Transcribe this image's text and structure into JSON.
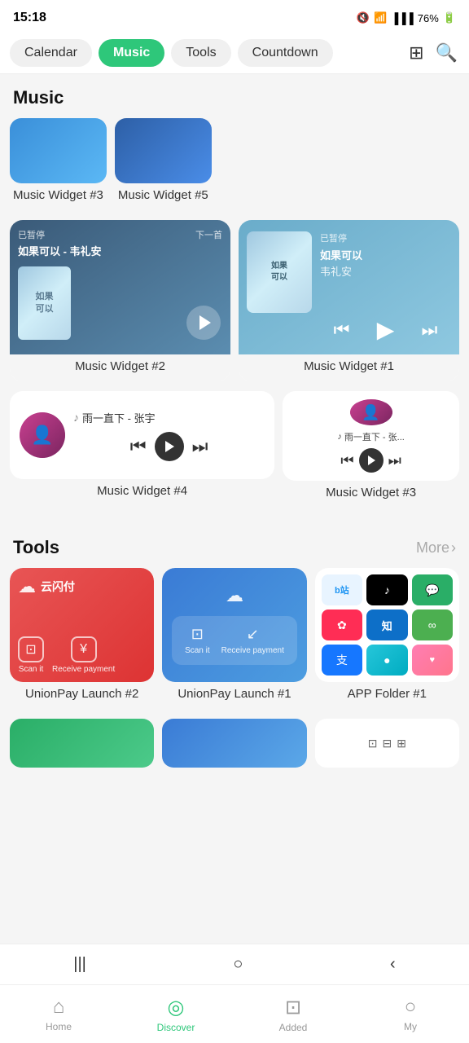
{
  "statusBar": {
    "time": "15:18",
    "battery": "76%"
  },
  "tabs": {
    "items": [
      {
        "id": "calendar",
        "label": "Calendar",
        "active": false
      },
      {
        "id": "music",
        "label": "Music",
        "active": true
      },
      {
        "id": "tools",
        "label": "Tools",
        "active": false
      },
      {
        "id": "countdown",
        "label": "Countdown",
        "active": false
      }
    ]
  },
  "musicSection": {
    "title": "Music",
    "widgets": {
      "widget3_top_label": "Music Widget #3",
      "widget5_top_label": "Music Widget #5",
      "widget2_label": "Music Widget #2",
      "widget1_label": "Music Widget #1",
      "widget4_label": "Music Widget #4",
      "widget3_label": "Music Widget #3"
    },
    "widget2": {
      "status": "已暂停",
      "next": "下一首",
      "song": "如果可以 - 韦礼安"
    },
    "widget1": {
      "status": "已暂停",
      "title": "如果可以",
      "artist": "韦礼安"
    },
    "widget4": {
      "song": "雨一直下 - 张宇",
      "controls": [
        "prev",
        "play",
        "next"
      ]
    },
    "widget3_small": {
      "song": "雨一直下 - 张...",
      "controls": [
        "prev",
        "play",
        "next"
      ]
    }
  },
  "toolsSection": {
    "title": "Tools",
    "moreLabel": "More",
    "widgets": {
      "unionpay2_label": "UnionPay Launch #2",
      "unionpay1_label": "UnionPay Launch #1",
      "appfolder_label": "APP Folder #1"
    },
    "unionpay2": {
      "logo": "云闪付",
      "scan_label": "Scan it",
      "receive_label": "Receive payment"
    },
    "unionpay1": {
      "scan_label": "Scan it",
      "receive_label": "Receive payment"
    },
    "appFolder": {
      "apps": [
        {
          "name": "bilibili",
          "label": "b站",
          "class": "app-bili"
        },
        {
          "name": "tiktok",
          "label": "♪",
          "class": "app-tiktok"
        },
        {
          "name": "wechat",
          "label": "💬",
          "class": "app-wechat"
        },
        {
          "name": "xiaohongshu",
          "label": "✿",
          "class": "app-red"
        },
        {
          "name": "zhihu",
          "label": "知",
          "class": "app-zhihu"
        },
        {
          "name": "app6",
          "label": "∞",
          "class": "app-green2"
        },
        {
          "name": "alipay",
          "label": "支",
          "class": "app-alipay"
        },
        {
          "name": "app8",
          "label": "●",
          "class": "app-teal"
        },
        {
          "name": "app9",
          "label": "♥",
          "class": "app-pink"
        }
      ]
    }
  },
  "bottomNav": {
    "items": [
      {
        "id": "home",
        "label": "Home",
        "icon": "⌂",
        "active": false
      },
      {
        "id": "discover",
        "label": "Discover",
        "icon": "◎",
        "active": true
      },
      {
        "id": "added",
        "label": "Added",
        "icon": "⊡",
        "active": false
      },
      {
        "id": "my",
        "label": "My",
        "icon": "○",
        "active": false
      }
    ]
  },
  "androidNav": {
    "recent": "|||",
    "home": "○",
    "back": "‹"
  }
}
